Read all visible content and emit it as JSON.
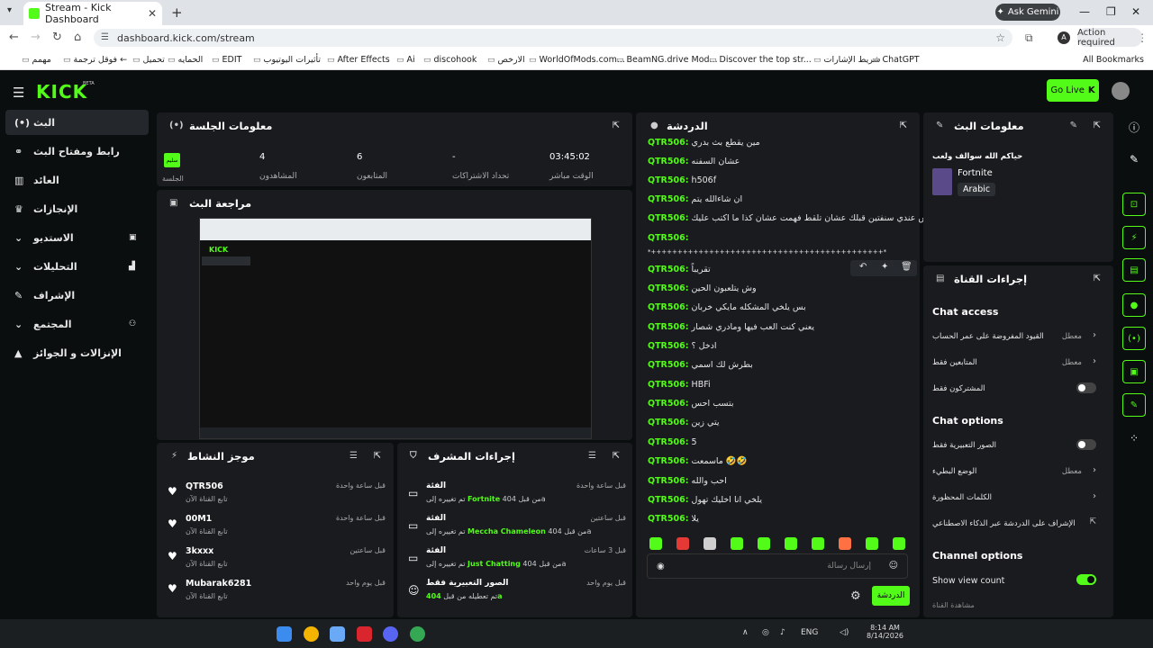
{
  "browser": {
    "tab_title": "Stream - Kick Dashboard",
    "url": "dashboard.kick.com/stream",
    "gemini": "Ask Gemini",
    "action_required": "Action required",
    "bookmarks": [
      "مهمم",
      "فوقل ترجمة ←",
      "تحميل",
      "الحمايه",
      "EDIT",
      "تأثيرات اليوتيوب",
      "After Effects",
      "Ai",
      "discohook",
      "الارخص",
      "WorldOfMods.com...",
      "BeamNG.drive Mod...",
      "Discover the top str...",
      "شريط الإشارات",
      "ChatGPT"
    ],
    "all_bookmarks": "All Bookmarks"
  },
  "app": {
    "logo": "KICK",
    "beta": "BETA",
    "go_live": "Go Live"
  },
  "sidebar": [
    {
      "label": "البث",
      "icon": "broadcast-icon"
    },
    {
      "label": "رابط ومفتاح البث",
      "icon": "link-icon"
    },
    {
      "label": "العائد",
      "icon": "money-icon"
    },
    {
      "label": "الإنجازات",
      "icon": "trophy-icon"
    },
    {
      "label": "الاستديو",
      "icon": "studio-icon"
    },
    {
      "label": "التحليلات",
      "icon": "analytics-icon"
    },
    {
      "label": "الإشراف",
      "icon": "wrench-icon"
    },
    {
      "label": "المجتمع",
      "icon": "community-icon"
    },
    {
      "label": "الإنزالات و الجوائز",
      "icon": "drops-icon"
    }
  ],
  "session": {
    "title": "معلومات الجلسة",
    "badge": "سليم",
    "session_label": "الجلسة",
    "viewers_value": "4",
    "viewers_label": "المشاهدون",
    "followers_value": "6",
    "followers_label": "المتابعون",
    "subs_value": "-",
    "subs_label": "تحداد الاشتراكات",
    "time_value": "03:45:02",
    "time_label": "الوقت مباشر"
  },
  "preview": {
    "title": "مراجعة البث"
  },
  "chat": {
    "title": "الدردشة",
    "messages": [
      {
        "user": "QTR506:",
        "text": "مين يقطع بث بدري"
      },
      {
        "user": "QTR506:",
        "text": "عشان السفنه"
      },
      {
        "user": "QTR506:",
        "text": "h506f"
      },
      {
        "user": "QTR506:",
        "text": "ان شاءالله يتم"
      },
      {
        "user": "QTR506:",
        "text": "بس عندي سنفتين قبلك عشان تلقط فهمت عشان كذا ما اكتب عليك"
      },
      {
        "user": "QTR506:",
        "text": ""
      },
      {
        "user": "",
        "text": "*++++++++++++++++++++++++++++++++++++++++++++*"
      },
      {
        "user": "QTR506:",
        "text": "تقريباً"
      },
      {
        "user": "QTR506:",
        "text": "وش يتلعبون الحين"
      },
      {
        "user": "QTR506:",
        "text": "بس يلخي المشكله مايكي خربان"
      },
      {
        "user": "QTR506:",
        "text": "يعني كنت العب فيها ومادري شصار"
      },
      {
        "user": "QTR506:",
        "text": "ادخل ؟"
      },
      {
        "user": "QTR506:",
        "text": "بطرش لك اسمي"
      },
      {
        "user": "QTR506:",
        "text": "HBFi"
      },
      {
        "user": "QTR506:",
        "text": "بتسب احس"
      },
      {
        "user": "QTR506:",
        "text": "يتي زين"
      },
      {
        "user": "QTR506:",
        "text": "5"
      },
      {
        "user": "QTR506:",
        "text": "ماسمعت 🤣🤣"
      },
      {
        "user": "QTR506:",
        "text": "احب والله"
      },
      {
        "user": "QTR506:",
        "text": "يلخي انا اخليك تهول"
      },
      {
        "user": "QTR506:",
        "text": "يلا"
      }
    ],
    "input_placeholder": "إرسال رسالة",
    "send_label": "الدردشة"
  },
  "stream_info": {
    "title": "معلومات البث",
    "stream_title": "حياكم الله سوالف ولعب",
    "game": "Fortnite",
    "language": "Arabic"
  },
  "channel_actions": {
    "title": "إجراءات القناة",
    "chat_access": "Chat access",
    "rows_access": [
      {
        "label": "القيود المفروضة على عمر الحساب",
        "value": "معطل",
        "type": "chevron"
      },
      {
        "label": "المتابعين فقط",
        "value": "معطل",
        "type": "chevron"
      },
      {
        "label": "المشتركون فقط",
        "value": "",
        "type": "toggle"
      }
    ],
    "chat_options": "Chat options",
    "rows_options": [
      {
        "label": "الصور التعبيرية فقط",
        "value": "",
        "type": "toggle"
      },
      {
        "label": "الوضع البطيء",
        "value": "معطل",
        "type": "chevron"
      },
      {
        "label": "الكلمات المحظورة",
        "value": "",
        "type": "chevron"
      },
      {
        "label": "الإشراف على الدردشة عبر الذكاء الاصطناعي",
        "value": "",
        "type": "external"
      }
    ],
    "channel_options": "Channel options",
    "show_view_count": "Show view count",
    "share_channel": "مشاهدة القناة"
  },
  "activity": {
    "title": "موجز النشاط",
    "items": [
      {
        "name": "QTR506",
        "sub": "تابع القناة الآن",
        "time": "قبل ساعة واحدة"
      },
      {
        "name": "00M1",
        "sub": "تابع القناة الآن",
        "time": "قبل ساعة واحدة"
      },
      {
        "name": "3kxxx",
        "sub": "تابع القناة الآن",
        "time": "قبل ساعتين"
      },
      {
        "name": "Mubarak6281",
        "sub": "تابع القناة الآن",
        "time": "قبل يوم واحد"
      }
    ]
  },
  "moderation": {
    "title": "إجراءات المشرف",
    "items": [
      {
        "name": "الفئة",
        "sub_pre": "تم تغييره إلى",
        "highlight": "Fortnite",
        "sub_post": "من قبل 404a",
        "time": "قبل ساعة واحدة"
      },
      {
        "name": "الفئة",
        "sub_pre": "تم تغييره إلى",
        "highlight": "Meccha Chameleon",
        "sub_post": "من قبل 404a",
        "time": "قبل ساعتين"
      },
      {
        "name": "الفئة",
        "sub_pre": "تم تغييره إلى",
        "highlight": "Just Chatting",
        "sub_post": "من قبل 404a",
        "time": "قبل 3 ساعات"
      },
      {
        "name": "الصور التعبيرية فقط",
        "sub_pre": "تم تعطيله من قبل",
        "highlight": "404a",
        "sub_post": "",
        "time": "قبل يوم واحد"
      }
    ]
  },
  "taskbar": {
    "lang": "ENG",
    "time": "8:14 AM",
    "date": "8/14/2026"
  },
  "colors": {
    "accent": "#53fc18",
    "panel": "#191b1f",
    "bg": "#0b0e0f"
  }
}
